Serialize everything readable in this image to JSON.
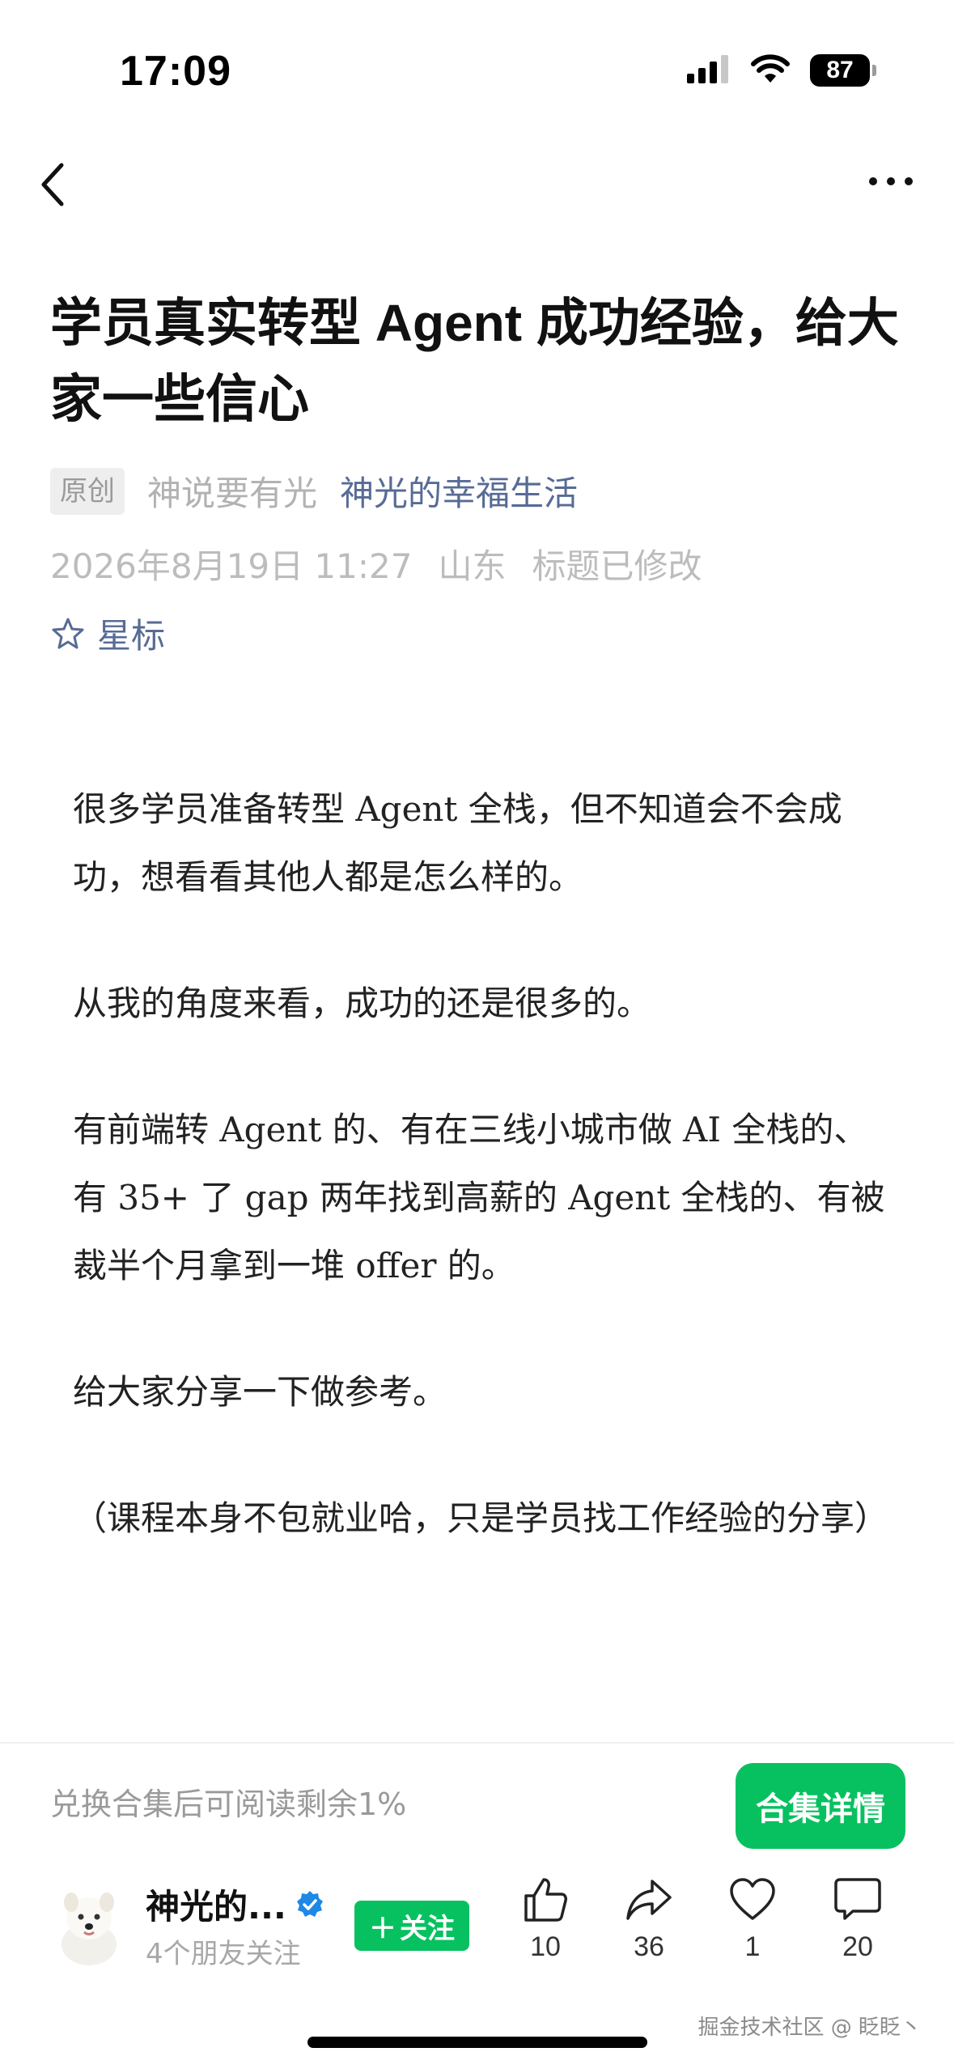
{
  "status_bar": {
    "time": "17:09",
    "battery": "87"
  },
  "article": {
    "title": "学员真实转型 Agent 成功经验，给大家一些信心",
    "badge": "原创",
    "author": "神说要有光",
    "account": "神光的幸福生活",
    "date": "2026年8月19日 11:27",
    "location": "山东",
    "edited": "标题已修改",
    "star_label": "星标",
    "paragraphs": [
      "很多学员准备转型 Agent 全栈，但不知道会不会成功，想看看其他人都是怎么样的。",
      "从我的角度来看，成功的还是很多的。",
      "有前端转 Agent 的、有在三线小城市做 AI 全栈的、有 35+ 了 gap 两年找到高薪的 Agent 全栈的、有被裁半个月拿到一堆 offer 的。",
      "给大家分享一下做参考。",
      "（课程本身不包就业哈，只是学员找工作经验的分享）"
    ]
  },
  "collection": {
    "text": "兑换合集后可阅读剩余1%",
    "button": "合集详情"
  },
  "footer": {
    "account_name": "神光的...",
    "friends": "4个朋友关注",
    "follow": "关注",
    "likes": "10",
    "shares": "36",
    "favorites": "1",
    "comments": "20"
  },
  "watermark": "掘金技术社区 @ 眨眨丶",
  "colors": {
    "accent_green": "#07c160",
    "link_blue": "#576b95",
    "verified_blue": "#1e88e5"
  }
}
